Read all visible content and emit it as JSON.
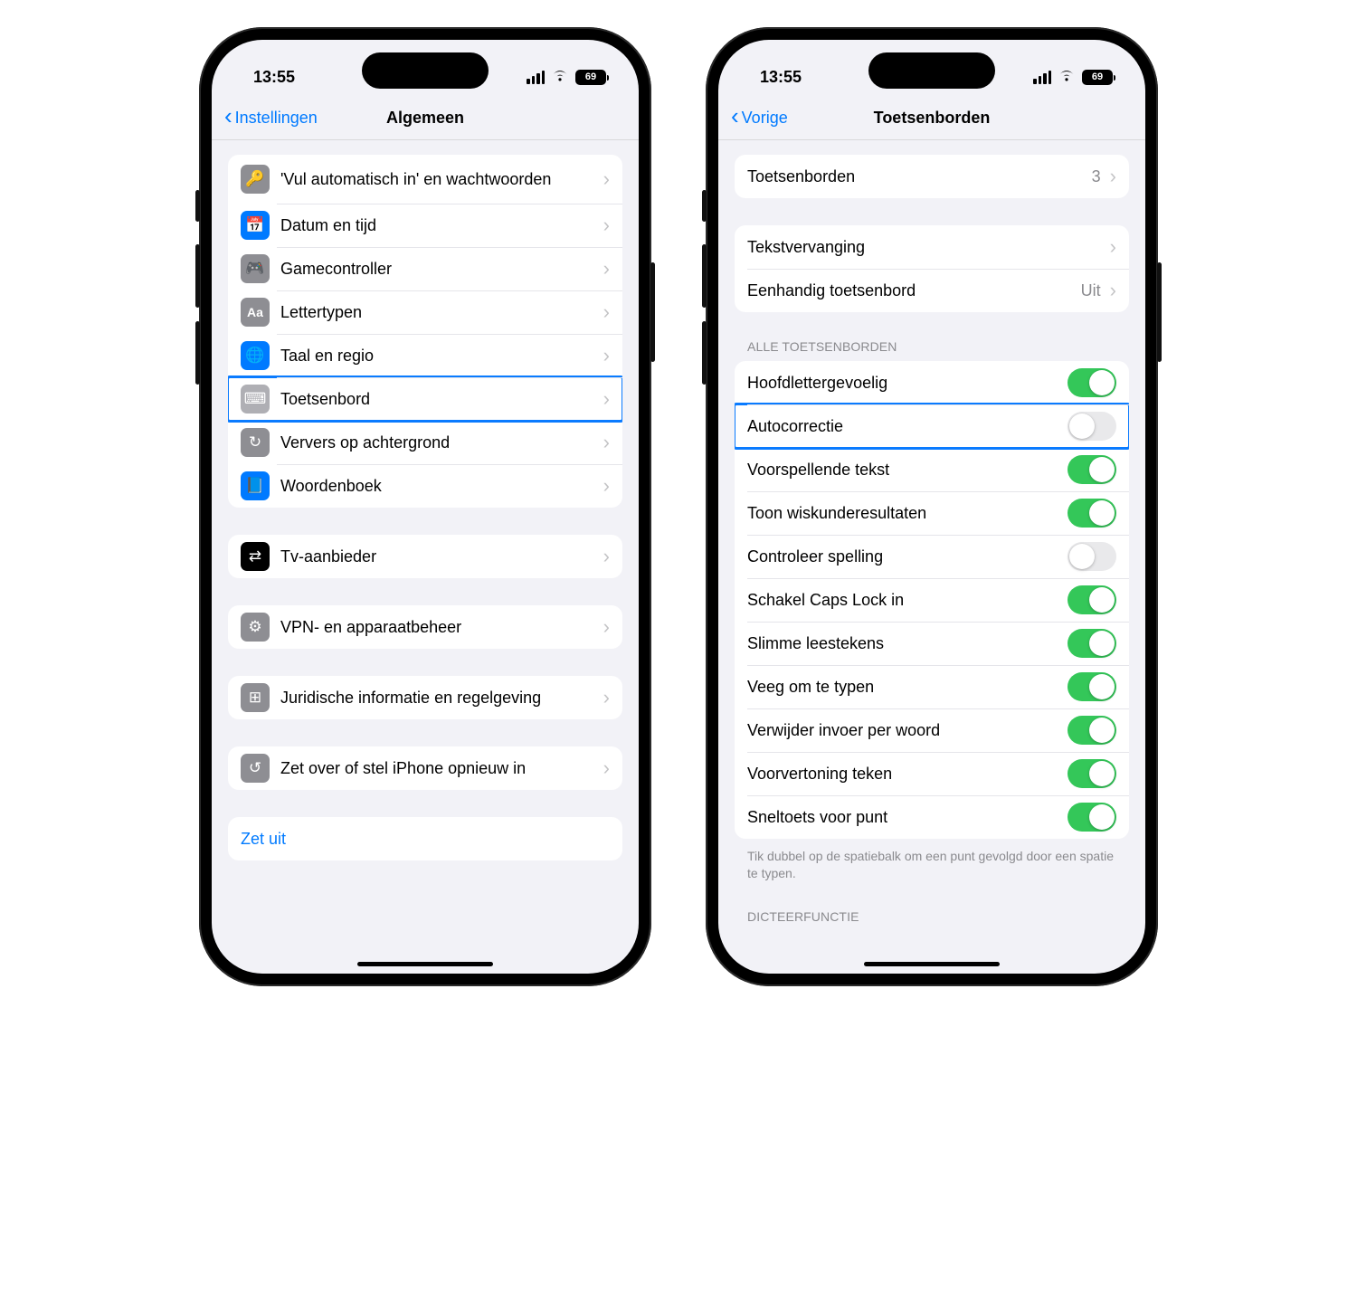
{
  "status": {
    "time": "13:55",
    "battery": "69"
  },
  "left": {
    "back": "Instellingen",
    "title": "Algemeen",
    "groups": [
      {
        "rows": [
          {
            "icon": "key-icon",
            "iconClass": "ic-gray",
            "label": "'Vul automatisch in' en wachtwoorden",
            "multiline": true
          },
          {
            "icon": "calendar-icon",
            "iconClass": "ic-blue",
            "label": "Datum en tijd"
          },
          {
            "icon": "gamepad-icon",
            "iconClass": "ic-gray",
            "label": "Gamecontroller"
          },
          {
            "icon": "font-icon",
            "iconClass": "ic-gray",
            "label": "Lettertypen",
            "glyph": "Aa"
          },
          {
            "icon": "globe-icon",
            "iconClass": "ic-blue",
            "label": "Taal en regio"
          },
          {
            "icon": "keyboard-icon",
            "iconClass": "ic-lgray",
            "label": "Toetsenbord",
            "highlighted": true
          },
          {
            "icon": "refresh-icon",
            "iconClass": "ic-gray",
            "label": "Ververs op achtergrond"
          },
          {
            "icon": "book-icon",
            "iconClass": "ic-blue",
            "label": "Woordenboek"
          }
        ]
      },
      {
        "rows": [
          {
            "icon": "tv-icon",
            "iconClass": "ic-black",
            "label": "Tv-aanbieder"
          }
        ]
      },
      {
        "rows": [
          {
            "icon": "gear-icon",
            "iconClass": "ic-gray",
            "label": "VPN- en apparaatbeheer"
          }
        ]
      },
      {
        "rows": [
          {
            "icon": "legal-icon",
            "iconClass": "ic-gray",
            "label": "Juridische informatie en regelgeving"
          }
        ]
      },
      {
        "rows": [
          {
            "icon": "reset-icon",
            "iconClass": "ic-gray",
            "label": "Zet over of stel iPhone opnieuw in"
          }
        ]
      },
      {
        "rows": [
          {
            "link": true,
            "label": "Zet uit"
          }
        ]
      }
    ]
  },
  "right": {
    "back": "Vorige",
    "title": "Toetsenborden",
    "groups": [
      {
        "rows": [
          {
            "label": "Toetsenborden",
            "value": "3"
          }
        ]
      },
      {
        "rows": [
          {
            "label": "Tekstvervanging"
          },
          {
            "label": "Eenhandig toetsenbord",
            "value": "Uit"
          }
        ]
      },
      {
        "header": "ALLE TOETSENBORDEN",
        "rows": [
          {
            "label": "Hoofdlettergevoelig",
            "toggle": true,
            "on": true
          },
          {
            "label": "Autocorrectie",
            "toggle": true,
            "on": false,
            "highlighted": true
          },
          {
            "label": "Voorspellende tekst",
            "toggle": true,
            "on": true
          },
          {
            "label": "Toon wiskunderesultaten",
            "toggle": true,
            "on": true
          },
          {
            "label": "Controleer spelling",
            "toggle": true,
            "on": false
          },
          {
            "label": "Schakel Caps Lock in",
            "toggle": true,
            "on": true
          },
          {
            "label": "Slimme leestekens",
            "toggle": true,
            "on": true
          },
          {
            "label": "Veeg om te typen",
            "toggle": true,
            "on": true
          },
          {
            "label": "Verwijder invoer per woord",
            "toggle": true,
            "on": true
          },
          {
            "label": "Voorvertoning teken",
            "toggle": true,
            "on": true
          },
          {
            "label": "Sneltoets voor punt",
            "toggle": true,
            "on": true
          }
        ],
        "footer": "Tik dubbel op de spatiebalk om een punt gevolgd door een spatie te typen."
      },
      {
        "header": "DICTEERFUNCTIE",
        "rows": []
      }
    ]
  },
  "iconGlyphs": {
    "key-icon": "🔑",
    "calendar-icon": "📅",
    "gamepad-icon": "🎮",
    "font-icon": "Aa",
    "globe-icon": "🌐",
    "keyboard-icon": "⌨",
    "refresh-icon": "↻",
    "book-icon": "📘",
    "tv-icon": "⇄",
    "gear-icon": "⚙",
    "legal-icon": "⊞",
    "reset-icon": "↺"
  }
}
